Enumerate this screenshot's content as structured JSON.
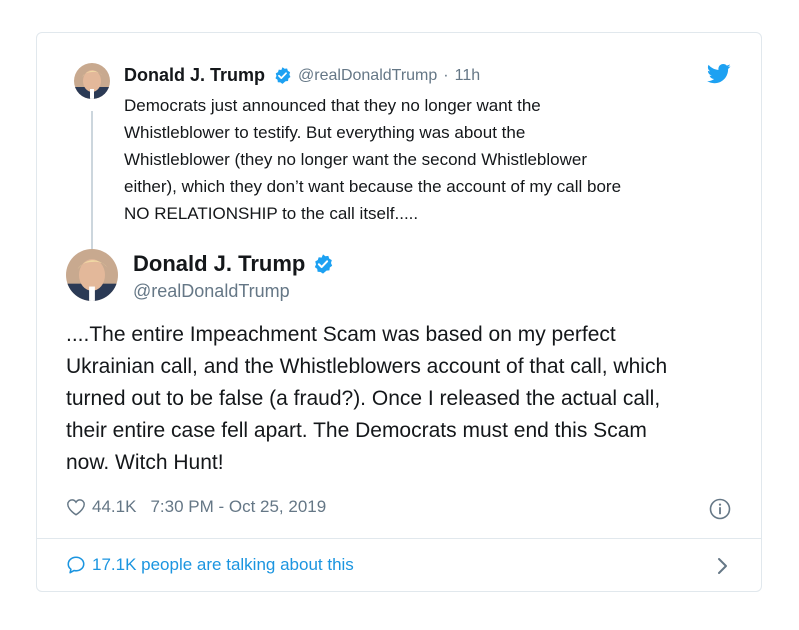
{
  "parent_tweet": {
    "author_name": "Donald J. Trump",
    "handle": "@realDonaldTrump",
    "separator": "·",
    "time": "11h",
    "lines": [
      "Democrats just announced that they no longer want the",
      "Whistleblower to testify. But everything was about the",
      "Whistleblower (they no longer want the second Whistleblower",
      "either), which they don’t want because the account of my call bore",
      "NO RELATIONSHIP to the call itself....."
    ]
  },
  "main_tweet": {
    "author_name": "Donald J. Trump",
    "handle": "@realDonaldTrump",
    "lines": [
      "....The entire Impeachment Scam was based on my perfect",
      "Ukrainian call, and the Whistleblowers account of that call, which",
      "turned out to be false (a fraud?). Once I released the actual call,",
      "their entire case fell apart. The Democrats must end this Scam",
      "now. Witch Hunt!"
    ],
    "likes": "44.1K",
    "timestamp": "7:30 PM - Oct 25, 2019"
  },
  "footer": {
    "talking_text": "17.1K people are talking about this"
  },
  "icons": {
    "verified": "verified-badge-icon",
    "twitter": "twitter-bird-icon",
    "like": "heart-icon",
    "info": "info-icon",
    "reply": "speech-bubble-icon",
    "more": "chevron-right-icon"
  },
  "colors": {
    "accent": "#1da1f2",
    "link": "#1b95e0",
    "muted": "#657786",
    "text": "#14171a",
    "border": "#e1e8ed"
  }
}
